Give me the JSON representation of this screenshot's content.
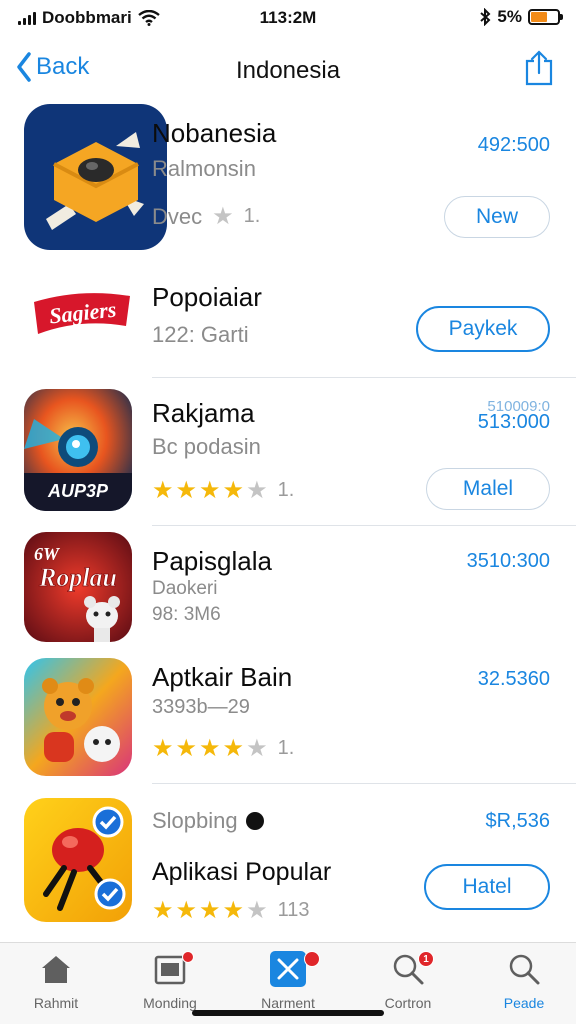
{
  "status_bar": {
    "carrier": "Doobbmari",
    "time": "113:2M",
    "battery_percent": "5%"
  },
  "nav": {
    "back_label": "Back",
    "title": "Indonesia"
  },
  "apps": [
    {
      "title": "Nobanesia",
      "subtitle": "Ralmonsin",
      "meta": "Dvec",
      "rating_count": "1.",
      "price": "492:500",
      "button": "New",
      "stars": 1
    },
    {
      "title": "Popoiaiar",
      "subtitle": "122: Garti",
      "button": "Paykek",
      "logo_text": "Sagiers"
    },
    {
      "title": "Rakjama",
      "subtitle": "Bc podasin",
      "rating_count": "1.",
      "price_line1": "510009:0",
      "price": "513:000",
      "button": "Malel",
      "stars": 4,
      "icon_text": "AUP3P"
    },
    {
      "title": "Papisglala",
      "subtitle": "Daokeri",
      "subtitle2": "98: 3M6",
      "price": "3510:300",
      "icon_text_top": "6W",
      "icon_text_main": "Roplau"
    },
    {
      "title": "Aptkair Bain",
      "subtitle": "3393b—29",
      "rating_count": "1.",
      "price": "32.5360",
      "stars": 4
    },
    {
      "title": "Aplikasi Popular",
      "subtitle": "Slopbing",
      "rating_count": "113",
      "price": "$R,536",
      "button": "Hatel",
      "stars": 4
    }
  ],
  "tabs": [
    {
      "label": "Rahmit",
      "icon": "home-icon"
    },
    {
      "label": "Monding",
      "icon": "archive-icon",
      "badge": ""
    },
    {
      "label": "Narment",
      "icon": "x-icon",
      "badge": ""
    },
    {
      "label": "Cortron",
      "icon": "search-icon",
      "badge": "1"
    },
    {
      "label": "Peade",
      "icon": "search-icon"
    }
  ],
  "colors": {
    "accent": "#1a86e0",
    "star": "#f5b80a",
    "badge": "#e0262a"
  }
}
